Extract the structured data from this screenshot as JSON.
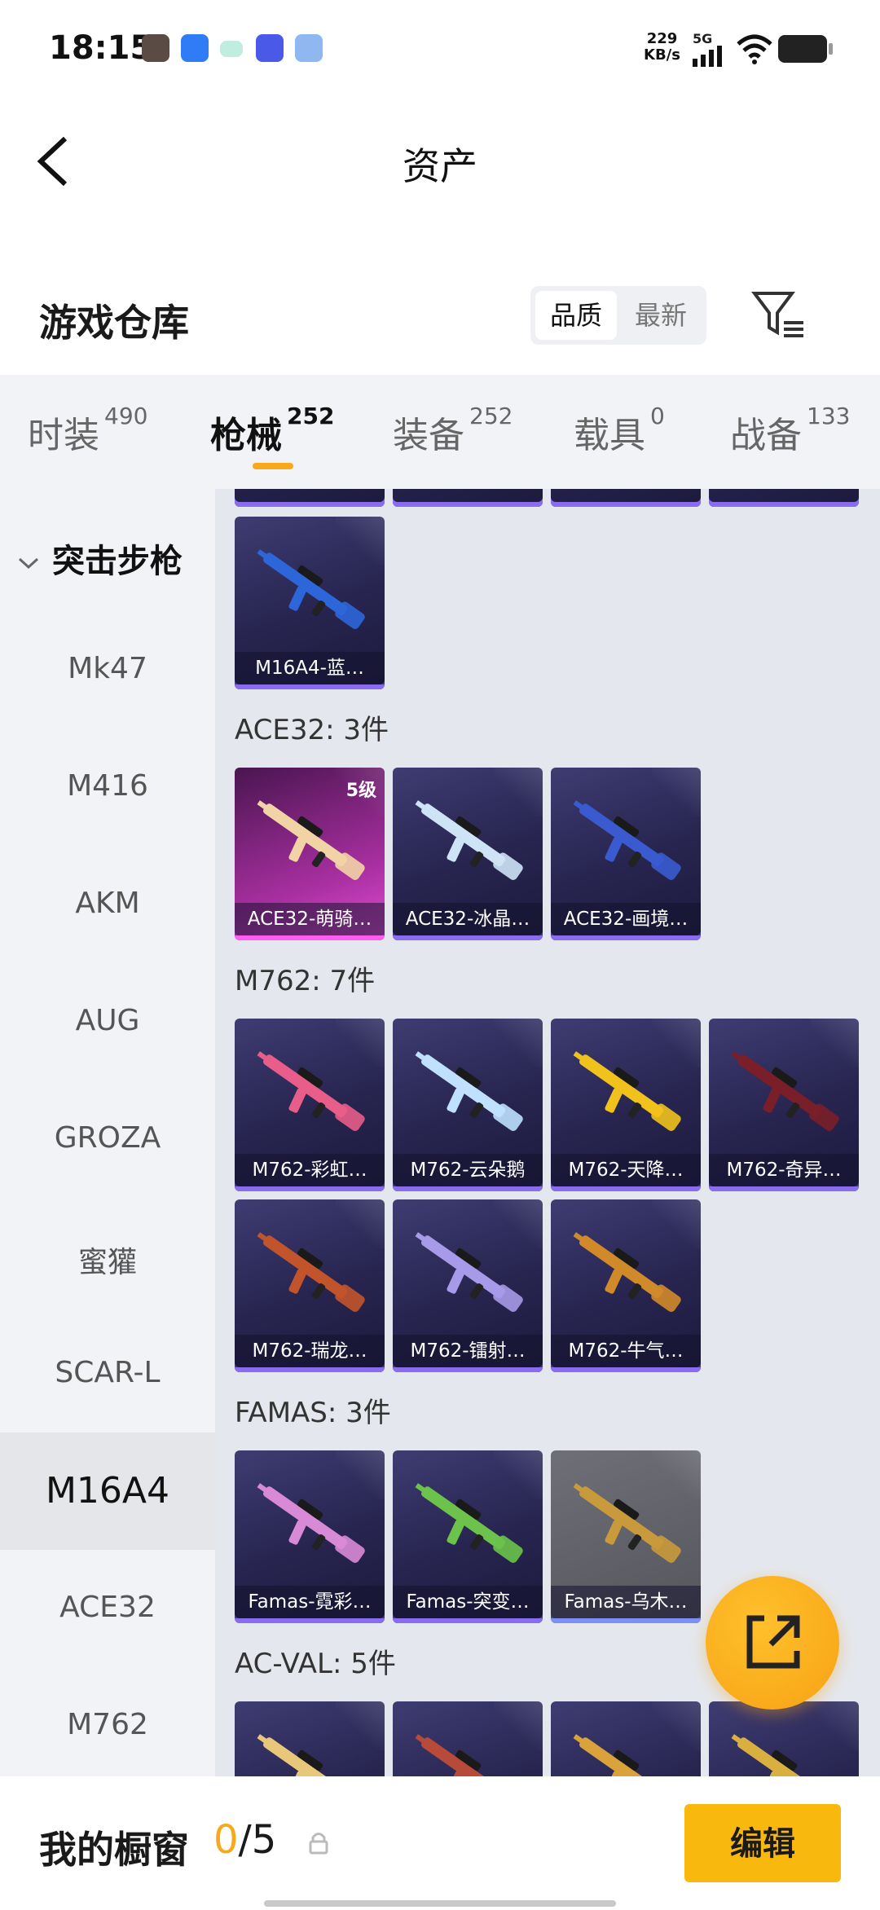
{
  "status_bar": {
    "time": "18:15",
    "net_speed_value": "229",
    "net_speed_unit": "KB/s",
    "network": "5G"
  },
  "header": {
    "title": "资产"
  },
  "warehouse": {
    "title": "游戏仓库",
    "sort_options": [
      "品质",
      "最新"
    ],
    "sort_selected": "品质"
  },
  "tabs": [
    {
      "label": "时装",
      "count": "490"
    },
    {
      "label": "枪械",
      "count": "252"
    },
    {
      "label": "装备",
      "count": "252"
    },
    {
      "label": "载具",
      "count": "0"
    },
    {
      "label": "战备",
      "count": "133"
    }
  ],
  "tab_active": "枪械",
  "sidebar": {
    "header": "突击步枪",
    "items": [
      "Mk47",
      "M416",
      "AKM",
      "AUG",
      "GROZA",
      "蜜獾",
      "SCAR-L",
      "M16A4",
      "ACE32",
      "M762"
    ],
    "active": "M16A4"
  },
  "groups": [
    {
      "title": "",
      "items": [
        {
          "label": "M16A4-蓝…",
          "color": "#2c66d8"
        }
      ]
    },
    {
      "title": "ACE32: 3件",
      "items": [
        {
          "label": "ACE32-萌骑…",
          "level": "5级",
          "color": "#f2d3a6",
          "style": "pink"
        },
        {
          "label": "ACE32-冰晶…",
          "color": "#cfe3f6"
        },
        {
          "label": "ACE32-画境…",
          "color": "#3a5bd0"
        }
      ]
    },
    {
      "title": "M762: 7件",
      "items": [
        {
          "label": "M762-彩虹…",
          "color": "#e85d8a"
        },
        {
          "label": "M762-云朵鹅",
          "color": "#bfe0ff"
        },
        {
          "label": "M762-天降…",
          "color": "#f2c21c"
        },
        {
          "label": "M762-奇异…",
          "color": "#7a1e2a"
        },
        {
          "label": "M762-瑞龙…",
          "color": "#c2542b"
        },
        {
          "label": "M762-镭射…",
          "color": "#a79ae8"
        },
        {
          "label": "M762-牛气…",
          "color": "#d08a2a"
        }
      ]
    },
    {
      "title": "FAMAS: 3件",
      "items": [
        {
          "label": "Famas-霓彩…",
          "color": "#d98ad6"
        },
        {
          "label": "Famas-突变…",
          "color": "#6cc24a"
        },
        {
          "label": "Famas-乌木…",
          "color": "#c99a3b",
          "style": "grey"
        }
      ]
    },
    {
      "title": "AC-VAL: 5件",
      "items": [
        {
          "label": "",
          "color": "#e8c77a"
        },
        {
          "label": "",
          "color": "#b84a3a"
        },
        {
          "label": "",
          "color": "#d9a23a"
        },
        {
          "label": "",
          "color": "#d9b040"
        }
      ]
    }
  ],
  "bottom": {
    "window_label": "我的橱窗",
    "count_current": "0",
    "count_sep": "/",
    "count_total": "5",
    "edit_label": "编辑"
  }
}
